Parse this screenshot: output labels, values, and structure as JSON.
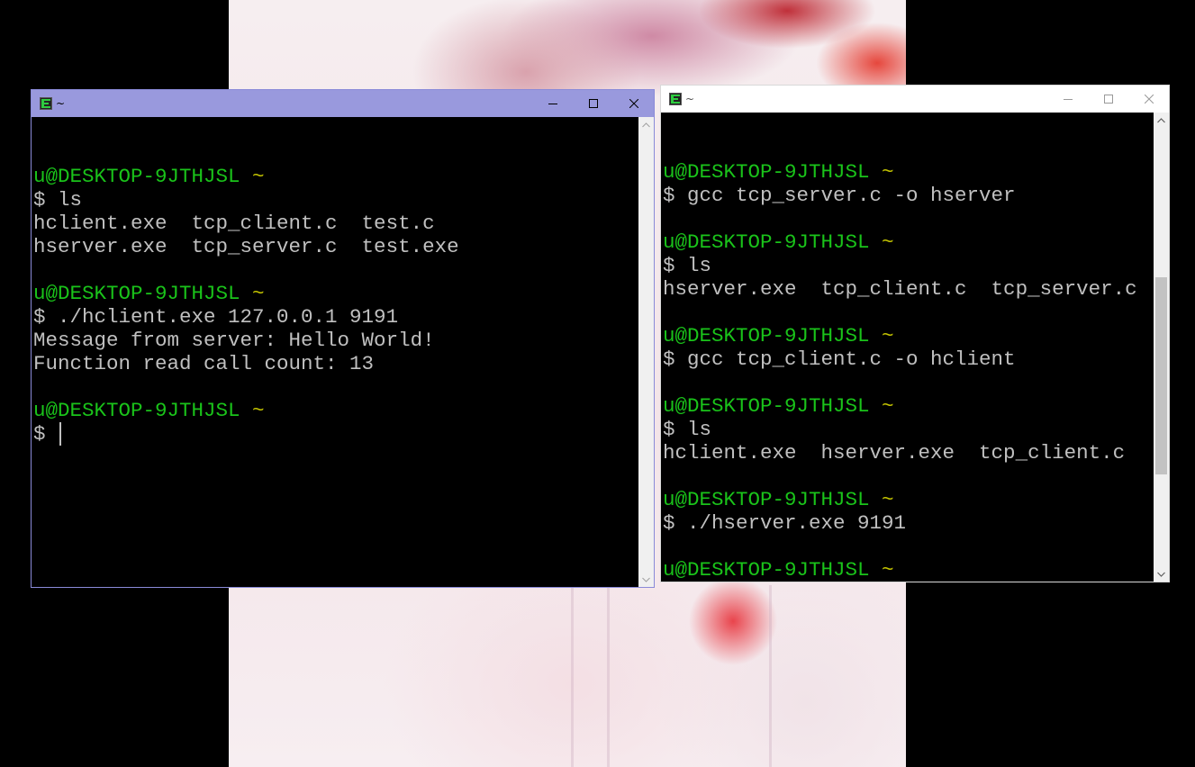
{
  "desktop": {
    "wallpaper": "pink-photo-wallpaper"
  },
  "left_window": {
    "title": "~",
    "icon": "mintty-terminal-icon",
    "controls": {
      "minimize": "minimize-icon",
      "maximize": "maximize-icon",
      "close": "close-icon"
    },
    "lines": [
      {
        "user": "",
        "tilde": "",
        "text": ""
      },
      {
        "user": "u@DESKTOP-9JTHJSL",
        "tilde": " ~",
        "text": ""
      },
      {
        "user": "",
        "tilde": "",
        "text": "$ ls"
      },
      {
        "user": "",
        "tilde": "",
        "text": "hclient.exe  tcp_client.c  test.c"
      },
      {
        "user": "",
        "tilde": "",
        "text": "hserver.exe  tcp_server.c  test.exe"
      },
      {
        "user": "",
        "tilde": "",
        "text": ""
      },
      {
        "user": "u@DESKTOP-9JTHJSL",
        "tilde": " ~",
        "text": ""
      },
      {
        "user": "",
        "tilde": "",
        "text": "$ ./hclient.exe 127.0.0.1 9191"
      },
      {
        "user": "",
        "tilde": "",
        "text": "Message from server: Hello World!"
      },
      {
        "user": "",
        "tilde": "",
        "text": "Function read call count: 13"
      },
      {
        "user": "",
        "tilde": "",
        "text": ""
      },
      {
        "user": "u@DESKTOP-9JTHJSL",
        "tilde": " ~",
        "text": ""
      }
    ],
    "prompt": "$"
  },
  "right_window": {
    "title": "~",
    "icon": "mintty-terminal-icon",
    "controls": {
      "minimize": "minimize-icon",
      "maximize": "maximize-icon",
      "close": "close-icon"
    },
    "lines": [
      {
        "user": "",
        "tilde": "",
        "text": ""
      },
      {
        "user": "u@DESKTOP-9JTHJSL",
        "tilde": " ~",
        "text": ""
      },
      {
        "user": "",
        "tilde": "",
        "text": "$ gcc tcp_server.c -o hserver"
      },
      {
        "user": "",
        "tilde": "",
        "text": ""
      },
      {
        "user": "u@DESKTOP-9JTHJSL",
        "tilde": " ~",
        "text": ""
      },
      {
        "user": "",
        "tilde": "",
        "text": "$ ls"
      },
      {
        "user": "",
        "tilde": "",
        "text": "hserver.exe  tcp_client.c  tcp_server.c"
      },
      {
        "user": "",
        "tilde": "",
        "text": ""
      },
      {
        "user": "u@DESKTOP-9JTHJSL",
        "tilde": " ~",
        "text": ""
      },
      {
        "user": "",
        "tilde": "",
        "text": "$ gcc tcp_client.c -o hclient"
      },
      {
        "user": "",
        "tilde": "",
        "text": ""
      },
      {
        "user": "u@DESKTOP-9JTHJSL",
        "tilde": " ~",
        "text": ""
      },
      {
        "user": "",
        "tilde": "",
        "text": "$ ls"
      },
      {
        "user": "",
        "tilde": "",
        "text": "hclient.exe  hserver.exe  tcp_client.c"
      },
      {
        "user": "",
        "tilde": "",
        "text": ""
      },
      {
        "user": "u@DESKTOP-9JTHJSL",
        "tilde": " ~",
        "text": ""
      },
      {
        "user": "",
        "tilde": "",
        "text": "$ ./hserver.exe 9191"
      },
      {
        "user": "",
        "tilde": "",
        "text": ""
      },
      {
        "user": "u@DESKTOP-9JTHJSL",
        "tilde": " ~",
        "text": ""
      }
    ],
    "prompt": "$",
    "scroll_position": 0.62
  },
  "colors": {
    "user_green": "#1ac31a",
    "tilde_yellow": "#c4c400",
    "text_gray": "#c0c0c0",
    "left_titlebar": "#9999dd",
    "right_titlebar": "#ffffff"
  }
}
